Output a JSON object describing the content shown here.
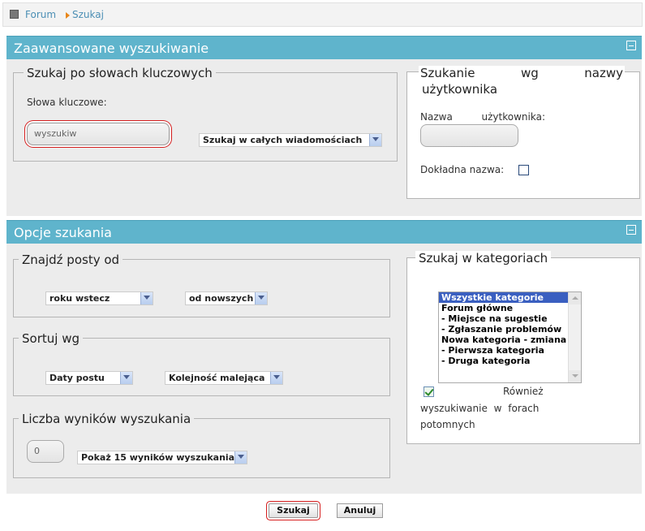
{
  "breadcrumb": {
    "forum": "Forum",
    "current": "Szukaj"
  },
  "advanced": {
    "title": "Zaawansowane wyszukiwanie",
    "keywords": {
      "legend": "Szukaj po słowach kluczowych",
      "label": "Słowa kluczowe:",
      "value": "wyszukiw",
      "scope": "Szukaj w całych wiadomościach"
    },
    "user": {
      "legend_line1": [
        "Szukanie",
        "wg",
        "nazwy"
      ],
      "legend_line2": "użytkownika",
      "label_words": [
        "Nazwa",
        "użytkownika:"
      ],
      "value": "",
      "exact_label": "Dokładna nazwa:"
    }
  },
  "options": {
    "title": "Opcje szukania",
    "find_from": {
      "legend": "Znajdź posty od",
      "period": "roku wstecz",
      "order": "od nowszych"
    },
    "sort": {
      "legend": "Sortuj wg",
      "by": "Daty postu",
      "direction": "Kolejność malejąca"
    },
    "results": {
      "legend": "Liczba wyników wyszukania",
      "value": "0",
      "show": "Pokaż 15 wyników wyszukania"
    },
    "categories": {
      "legend": "Szukaj w kategoriach",
      "items": [
        "Wszystkie kategorie",
        "Forum główne",
        "- Miejsce na sugestie",
        "- Zgłaszanie problemów",
        "Nowa kategoria - zmiana",
        "- Pierwsza kategoria",
        "- Druga kategoria"
      ],
      "subforums_word": "Również",
      "subforums_line2": "wyszukiwanie w forach",
      "subforums_line3": "potomnych"
    }
  },
  "buttons": {
    "search": "Szukaj",
    "cancel": "Anuluj"
  }
}
